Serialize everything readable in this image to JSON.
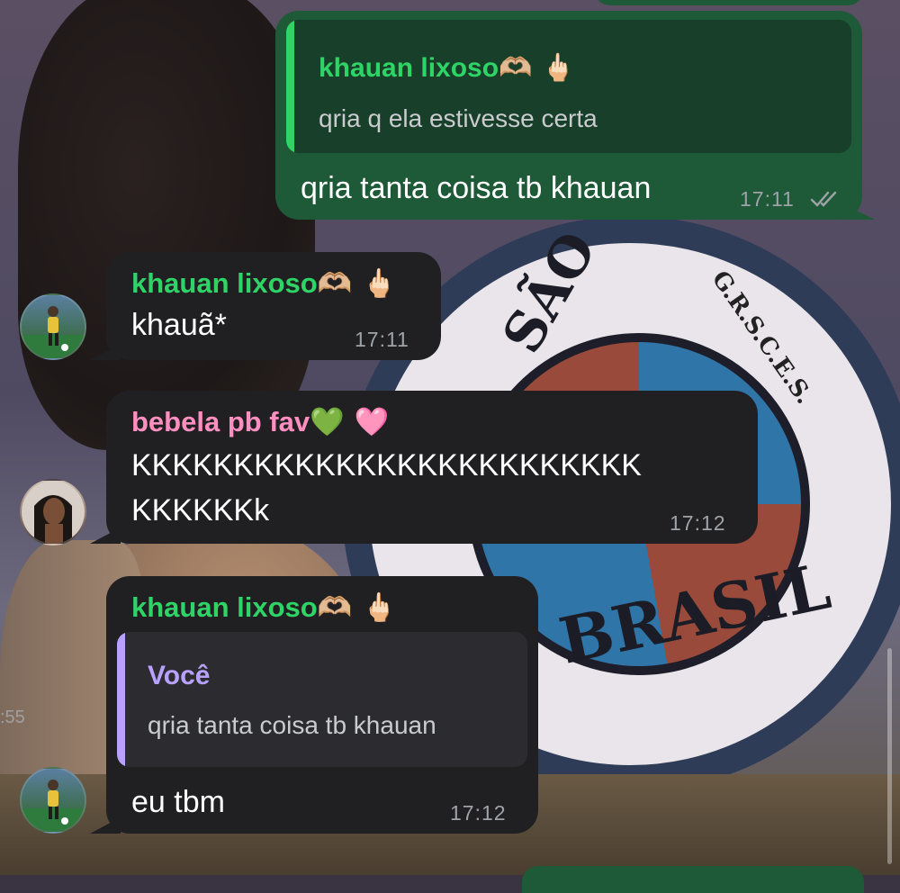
{
  "colors": {
    "outgoing_bubble": "#1e5a38",
    "incoming_bubble": "#202023",
    "green_name": "#2fd466",
    "pink_name": "#ff8fc1",
    "purple_name": "#b9a2ff",
    "timestamp": "#9fa3a8"
  },
  "wallpaper": {
    "partial_time": ":55",
    "seal_words": [
      "SÃO",
      "BRASIL",
      "G.R.S.C.E.S."
    ]
  },
  "messages": [
    {
      "direction": "outgoing",
      "quote": {
        "name": "khauan lixoso",
        "name_emoji": "🫶🏼 🖕🏻",
        "text": "qria q ela estivesse certa"
      },
      "text": "qria tanta coisa tb khauan",
      "time": "17:11",
      "status_icon": "double-check-icon"
    },
    {
      "direction": "incoming",
      "sender": "khauan lixoso",
      "sender_emoji": "🫶🏼 🖕🏻",
      "text": "khauã*",
      "time": "17:11",
      "avatar": "soccer-player-avatar"
    },
    {
      "direction": "incoming",
      "sender": "bebela pb fav",
      "sender_emoji": "💚 🩷",
      "text_line1": "KKKKKKKKKKKKKKKKKKKKKKKKK",
      "text_line2": "KKKKKKk",
      "time": "17:12",
      "avatar": "girl-selfie-avatar"
    },
    {
      "direction": "incoming",
      "sender": "khauan lixoso",
      "sender_emoji": "🫶🏼 🖕🏻",
      "quote": {
        "name": "Você",
        "text": "qria tanta coisa tb khauan"
      },
      "text": "eu tbm",
      "time": "17:12",
      "avatar": "soccer-player-avatar"
    }
  ]
}
